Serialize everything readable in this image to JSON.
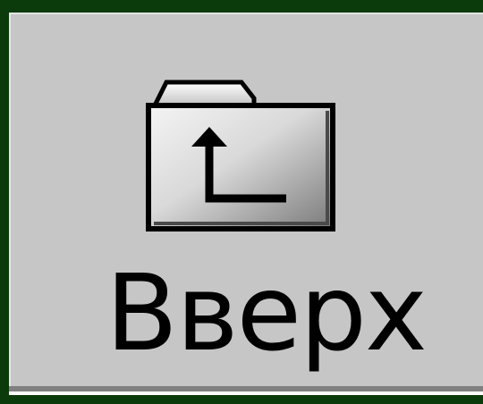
{
  "toolbar": {
    "up_button": {
      "label": "Вверх",
      "icon": "folder-up-icon"
    }
  },
  "colors": {
    "frame": "#0b3a0b",
    "button_face": "#c6c6c6",
    "shadow": "#808080",
    "highlight": "#ffffff",
    "text": "#000000"
  }
}
